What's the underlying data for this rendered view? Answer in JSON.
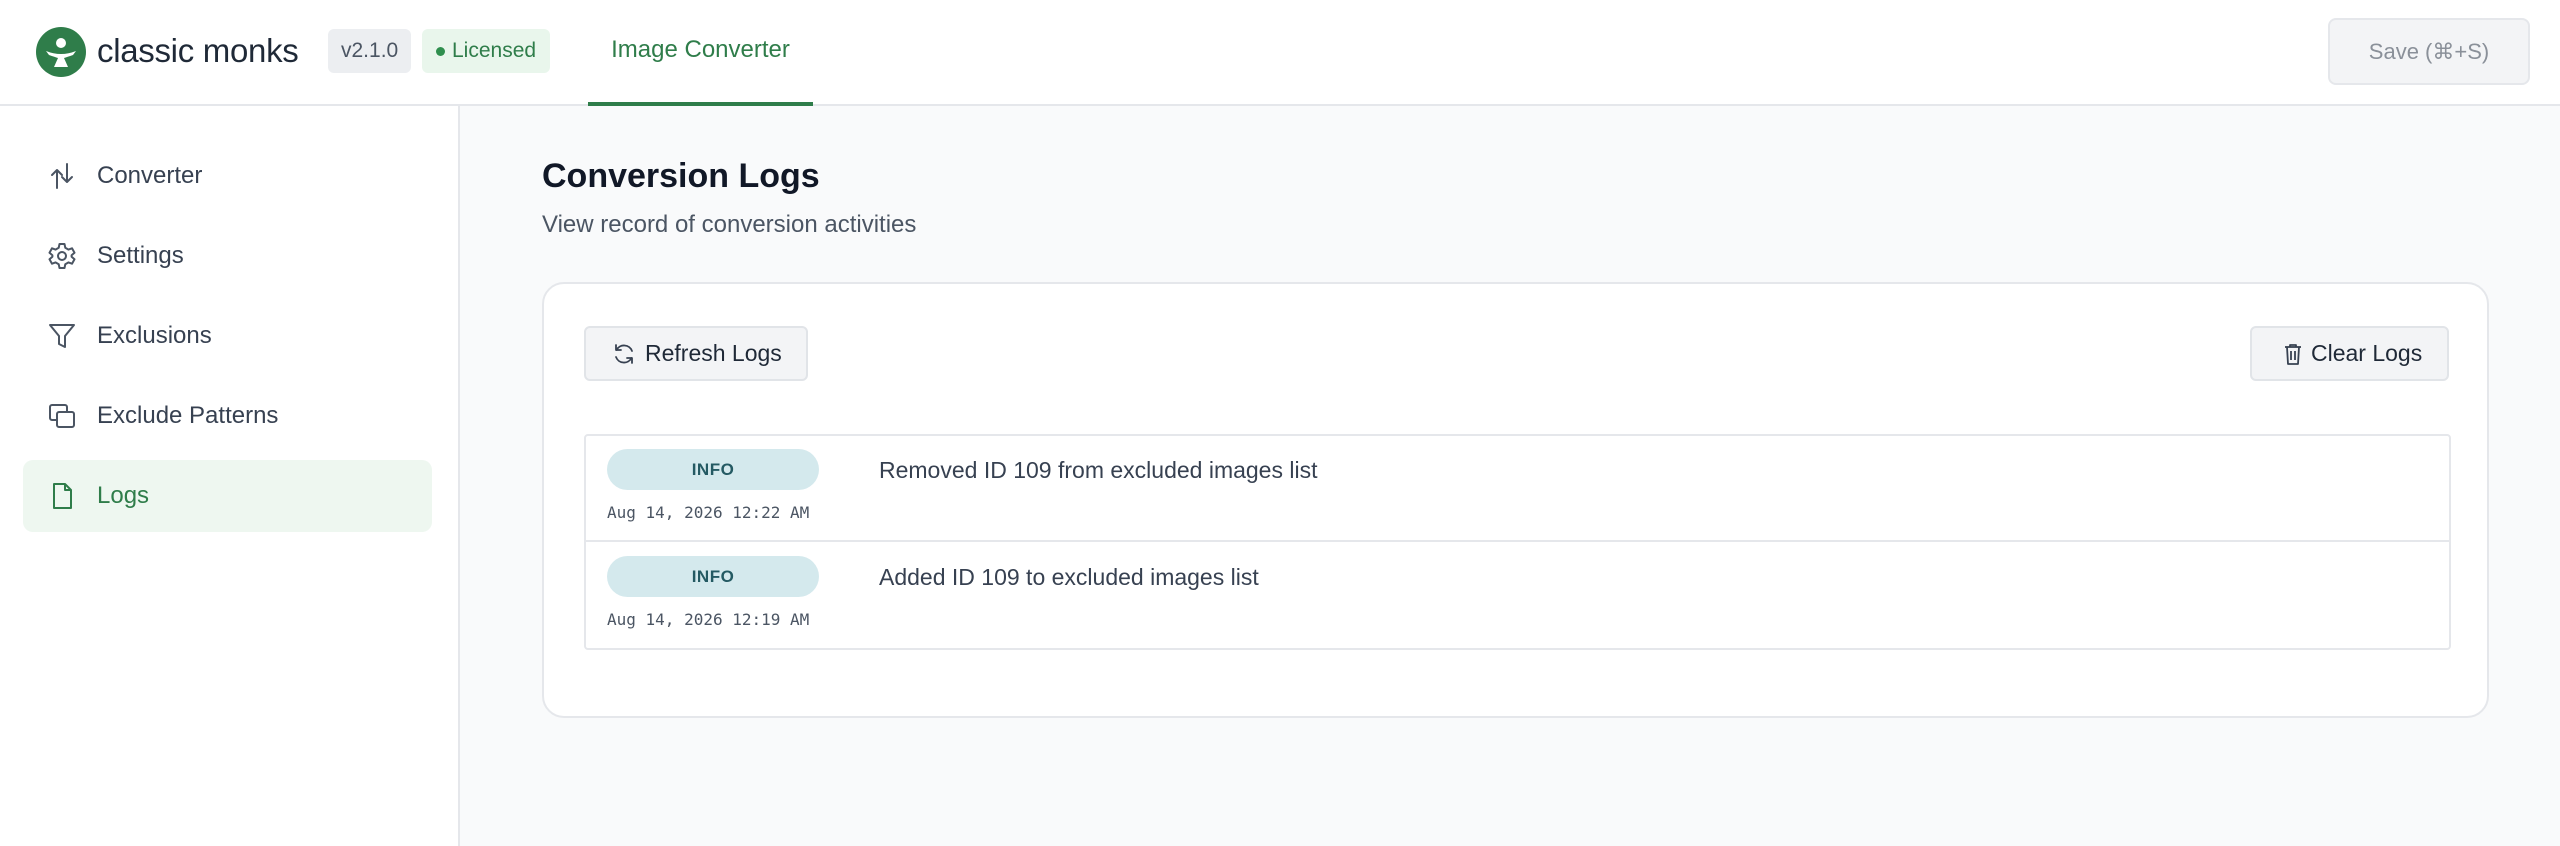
{
  "header": {
    "brand": "classic monks",
    "version": "v2.1.0",
    "license": "Licensed",
    "tab": "Image Converter",
    "save_label": "Save (⌘+S)"
  },
  "sidebar": {
    "items": [
      {
        "label": "Converter",
        "icon": "arrows-up-down-icon"
      },
      {
        "label": "Settings",
        "icon": "gear-icon"
      },
      {
        "label": "Exclusions",
        "icon": "filter-icon"
      },
      {
        "label": "Exclude Patterns",
        "icon": "copy-icon"
      },
      {
        "label": "Logs",
        "icon": "document-icon",
        "active": true
      }
    ]
  },
  "main": {
    "title": "Conversion Logs",
    "subtitle": "View record of conversion activities",
    "refresh_label": "Refresh Logs",
    "clear_label": "Clear Logs",
    "logs": [
      {
        "level": "INFO",
        "time": "Aug 14, 2026 12:22 AM",
        "message": "Removed ID 109 from excluded images list"
      },
      {
        "level": "INFO",
        "time": "Aug 14, 2026 12:19 AM",
        "message": "Added ID 109 to excluded images list"
      }
    ]
  },
  "colors": {
    "accent": "#2f7d4a",
    "active_bg": "#eef7f0",
    "badge_bg": "#d4e9ed",
    "badge_text": "#245a63"
  }
}
